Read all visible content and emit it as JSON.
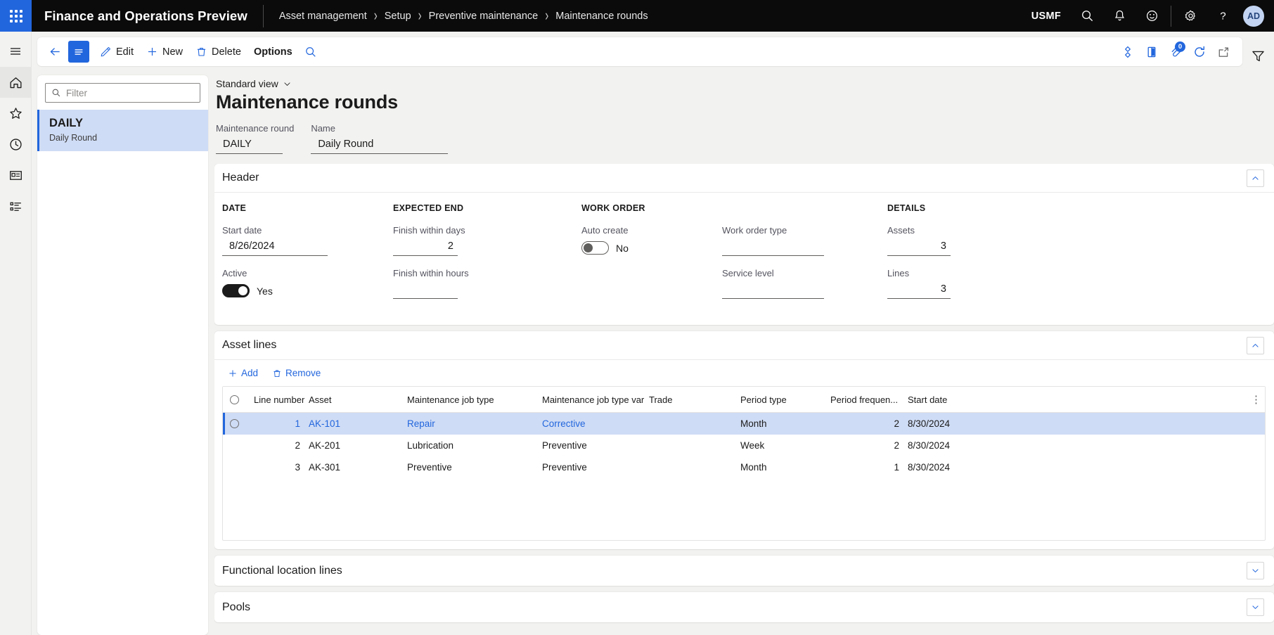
{
  "topbar": {
    "app_title": "Finance and Operations Preview",
    "waffle_icon": "waffle-grid-icon",
    "breadcrumb": [
      "Asset management",
      "Setup",
      "Preventive maintenance",
      "Maintenance rounds"
    ],
    "company": "USMF",
    "icons": [
      "search-icon",
      "notification-bell-icon",
      "feedback-smiley-icon",
      "settings-gear-icon",
      "help-question-icon"
    ],
    "avatar_initials": "AD"
  },
  "rail": {
    "items": [
      {
        "name": "hamburger-menu",
        "icon": "hamburger-icon"
      },
      {
        "name": "home",
        "icon": "home-icon"
      },
      {
        "name": "favorites",
        "icon": "star-icon"
      },
      {
        "name": "recent",
        "icon": "clock-icon"
      },
      {
        "name": "workspaces",
        "icon": "workspace-card-icon"
      },
      {
        "name": "modules",
        "icon": "list-icon"
      }
    ]
  },
  "actionpane": {
    "back_icon": "back-arrow-icon",
    "show_list_icon": "list-lines-icon",
    "edit_label": "Edit",
    "new_label": "New",
    "delete_label": "Delete",
    "options_label": "Options",
    "search_icon": "search-icon",
    "right_icons": [
      {
        "name": "copilot-icon",
        "badge": ""
      },
      {
        "name": "office-export-icon",
        "badge": ""
      },
      {
        "name": "attachments-icon",
        "badge": "0"
      },
      {
        "name": "refresh-icon",
        "badge": ""
      },
      {
        "name": "open-in-new-window-icon",
        "badge": ""
      }
    ],
    "filter_icon": "filter-funnel-icon"
  },
  "listpanel": {
    "filter_placeholder": "Filter",
    "filter_value": "",
    "search_icon": "search-icon",
    "items": [
      {
        "title": "DAILY",
        "subtitle": "Daily Round",
        "selected": true
      }
    ]
  },
  "page": {
    "view_name": "Standard view",
    "view_chevron": "chevron-down-icon",
    "title": "Maintenance rounds",
    "id_fields": [
      {
        "label": "Maintenance round",
        "value": "DAILY"
      },
      {
        "label": "Name",
        "value": "Daily Round"
      }
    ]
  },
  "header_section": {
    "title": "Header",
    "collapse_icon": "chevron-up-icon",
    "groups": {
      "date": {
        "heading": "DATE",
        "start_date_label": "Start date",
        "start_date_value": "8/26/2024",
        "active_label": "Active",
        "active_value": "Yes",
        "active_on": true
      },
      "expected_end": {
        "heading": "EXPECTED END",
        "finish_days_label": "Finish within days",
        "finish_days_value": "2",
        "finish_hours_label": "Finish within hours",
        "finish_hours_value": ""
      },
      "work_order": {
        "heading": "WORK ORDER",
        "auto_create_label": "Auto create",
        "auto_create_value": "No",
        "auto_create_on": false
      },
      "work_order_type": {
        "work_order_type_label": "Work order type",
        "work_order_type_value": "",
        "service_level_label": "Service level",
        "service_level_value": ""
      },
      "details": {
        "heading": "DETAILS",
        "assets_label": "Assets",
        "assets_value": "3",
        "lines_label": "Lines",
        "lines_value": "3"
      }
    }
  },
  "asset_lines": {
    "title": "Asset lines",
    "collapse_icon": "chevron-up-icon",
    "toolbar": {
      "add_label": "Add",
      "add_icon": "plus-icon",
      "remove_label": "Remove",
      "remove_icon": "trash-icon"
    },
    "columns": [
      "Line number",
      "Asset",
      "Maintenance job type",
      "Maintenance job type vari...",
      "Trade",
      "Period type",
      "Period frequen...",
      "Start date"
    ],
    "overflow_icon": "more-options-icon",
    "rows": [
      {
        "line_number": "1",
        "asset": "AK-101",
        "job_type": "Repair",
        "job_type_variant": "Corrective",
        "trade": "",
        "period_type": "Month",
        "period_frequency": "2",
        "start_date": "8/30/2024",
        "selected": true
      },
      {
        "line_number": "2",
        "asset": "AK-201",
        "job_type": "Lubrication",
        "job_type_variant": "Preventive",
        "trade": "",
        "period_type": "Week",
        "period_frequency": "2",
        "start_date": "8/30/2024",
        "selected": false
      },
      {
        "line_number": "3",
        "asset": "AK-301",
        "job_type": "Preventive",
        "job_type_variant": "Preventive",
        "trade": "",
        "period_type": "Month",
        "period_frequency": "1",
        "start_date": "8/30/2024",
        "selected": false
      }
    ]
  },
  "functional_location_lines": {
    "title": "Functional location lines",
    "expand_icon": "chevron-down-icon"
  },
  "pools": {
    "title": "Pools",
    "expand_icon": "chevron-down-icon"
  },
  "colors": {
    "accent": "#2266dd",
    "topbar_bg": "#0b0b0b",
    "selection_bg": "#cfdcf5",
    "page_bg": "#f2f2f0"
  }
}
